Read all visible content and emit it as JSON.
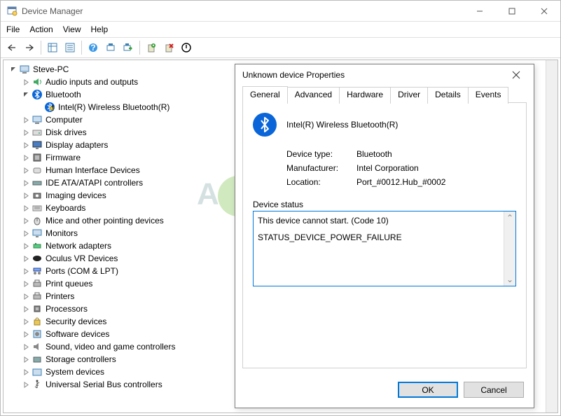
{
  "window": {
    "title": "Device Manager"
  },
  "menu": {
    "file": "File",
    "action": "Action",
    "view": "View",
    "help": "Help"
  },
  "tree": {
    "root": "Steve-PC",
    "items": [
      "Audio inputs and outputs",
      "Bluetooth",
      "Computer",
      "Disk drives",
      "Display adapters",
      "Firmware",
      "Human Interface Devices",
      "IDE ATA/ATAPI controllers",
      "Imaging devices",
      "Keyboards",
      "Mice and other pointing devices",
      "Monitors",
      "Network adapters",
      "Oculus VR Devices",
      "Ports (COM & LPT)",
      "Print queues",
      "Printers",
      "Processors",
      "Security devices",
      "Software devices",
      "Sound, video and game controllers",
      "Storage controllers",
      "System devices",
      "Universal Serial Bus controllers"
    ],
    "bluetooth_child": "Intel(R) Wireless Bluetooth(R)"
  },
  "dialog": {
    "title": "Unknown device Properties",
    "tabs": {
      "general": "General",
      "advanced": "Advanced",
      "hardware": "Hardware",
      "driver": "Driver",
      "details": "Details",
      "events": "Events"
    },
    "device_name": "Intel(R) Wireless Bluetooth(R)",
    "labels": {
      "type": "Device type:",
      "manufacturer": "Manufacturer:",
      "location": "Location:",
      "status_group": "Device status"
    },
    "values": {
      "type": "Bluetooth",
      "manufacturer": "Intel Corporation",
      "location": "Port_#0012.Hub_#0002"
    },
    "status_line1": "This device cannot start. (Code 10)",
    "status_line2": "STATUS_DEVICE_POWER_FAILURE",
    "buttons": {
      "ok": "OK",
      "cancel": "Cancel"
    }
  }
}
